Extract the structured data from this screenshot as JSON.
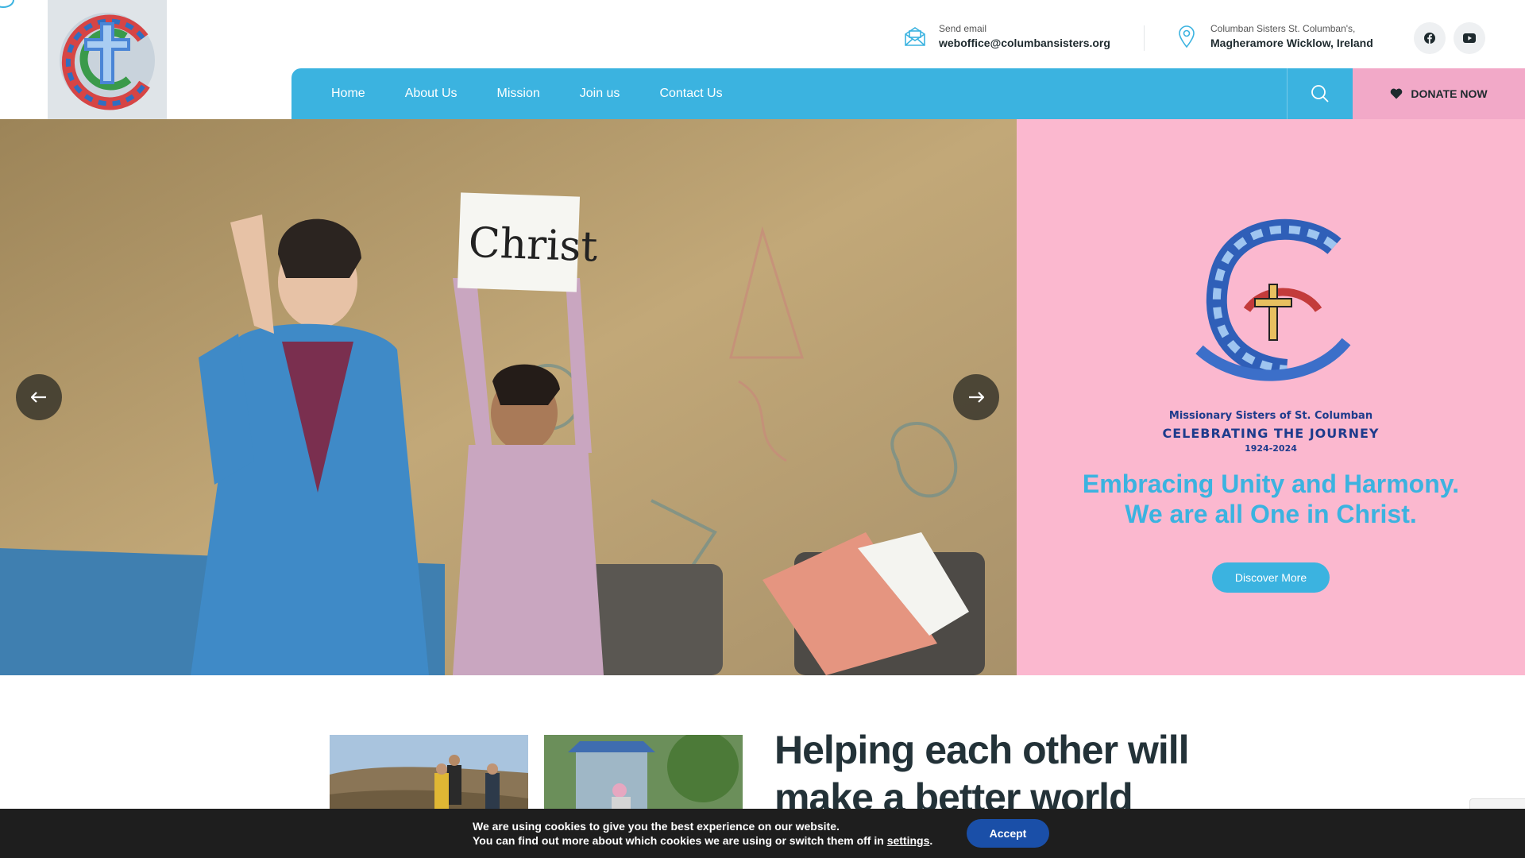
{
  "header": {
    "email": {
      "label": "Send email",
      "value": "weboffice@columbansisters.org",
      "icon": "envelope-icon"
    },
    "address": {
      "label": "Columban Sisters St. Columban's,",
      "value": "Magheramore Wicklow, Ireland",
      "icon": "map-pin-icon"
    },
    "social": [
      {
        "name": "facebook",
        "icon": "facebook-icon"
      },
      {
        "name": "youtube",
        "icon": "youtube-icon"
      }
    ]
  },
  "nav": {
    "items": [
      "Home",
      "About Us",
      "Mission",
      "Join us",
      "Contact Us"
    ],
    "donate_label": "DONATE NOW"
  },
  "hero": {
    "photo_sign_text": "Christ",
    "promo": {
      "org_line1": "Missionary Sisters of St. Columban",
      "org_line2": "CELEBRATING THE JOURNEY",
      "org_line3": "1924-2024",
      "headline_line1": "Embracing Unity and Harmony.",
      "headline_line2": "We are all One in Christ.",
      "cta_label": "Discover More"
    }
  },
  "section": {
    "title": "Helping each other will make a better world"
  },
  "cookie": {
    "line1": "We are using cookies to give you the best experience on our website.",
    "line2_prefix": "You can find out more about which cookies we are using or switch them off in ",
    "line2_link": "settings",
    "line2_suffix": ".",
    "accept_label": "Accept"
  },
  "colors": {
    "accent_blue": "#3bb3e0",
    "donate_pink": "#f2a9c8",
    "promo_pink": "#fbb8cf",
    "accept_blue": "#1a4fa8"
  }
}
